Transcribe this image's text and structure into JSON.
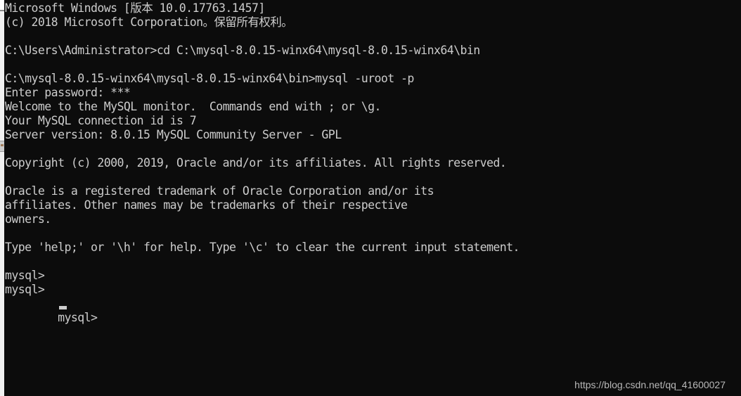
{
  "window": {
    "title": "Command Prompt - mysql  -uroot  -p",
    "background_color": "#0c0c0c",
    "foreground_color": "#cccccc"
  },
  "terminal": {
    "lines": [
      "Microsoft Windows [版本 10.0.17763.1457]",
      "(c) 2018 Microsoft Corporation。保留所有权利。",
      "",
      "C:\\Users\\Administrator>cd C:\\mysql-8.0.15-winx64\\mysql-8.0.15-winx64\\bin",
      "",
      "C:\\mysql-8.0.15-winx64\\mysql-8.0.15-winx64\\bin>mysql -uroot -p",
      "Enter password: ***",
      "Welcome to the MySQL monitor.  Commands end with ; or \\g.",
      "Your MySQL connection id is 7",
      "Server version: 8.0.15 MySQL Community Server - GPL",
      "",
      "Copyright (c) 2000, 2019, Oracle and/or its affiliates. All rights reserved.",
      "",
      "Oracle is a registered trademark of Oracle Corporation and/or its",
      "affiliates. Other names may be trademarks of their respective",
      "owners.",
      "",
      "Type 'help;' or '\\h' for help. Type '\\c' to clear the current input statement.",
      "",
      "mysql>",
      "mysql>",
      "mysql>"
    ],
    "cursor": {
      "visible": true,
      "style": "underline",
      "column": 8,
      "row": 22
    }
  },
  "watermark": {
    "text": "https://blog.csdn.net/qq_41600027"
  }
}
